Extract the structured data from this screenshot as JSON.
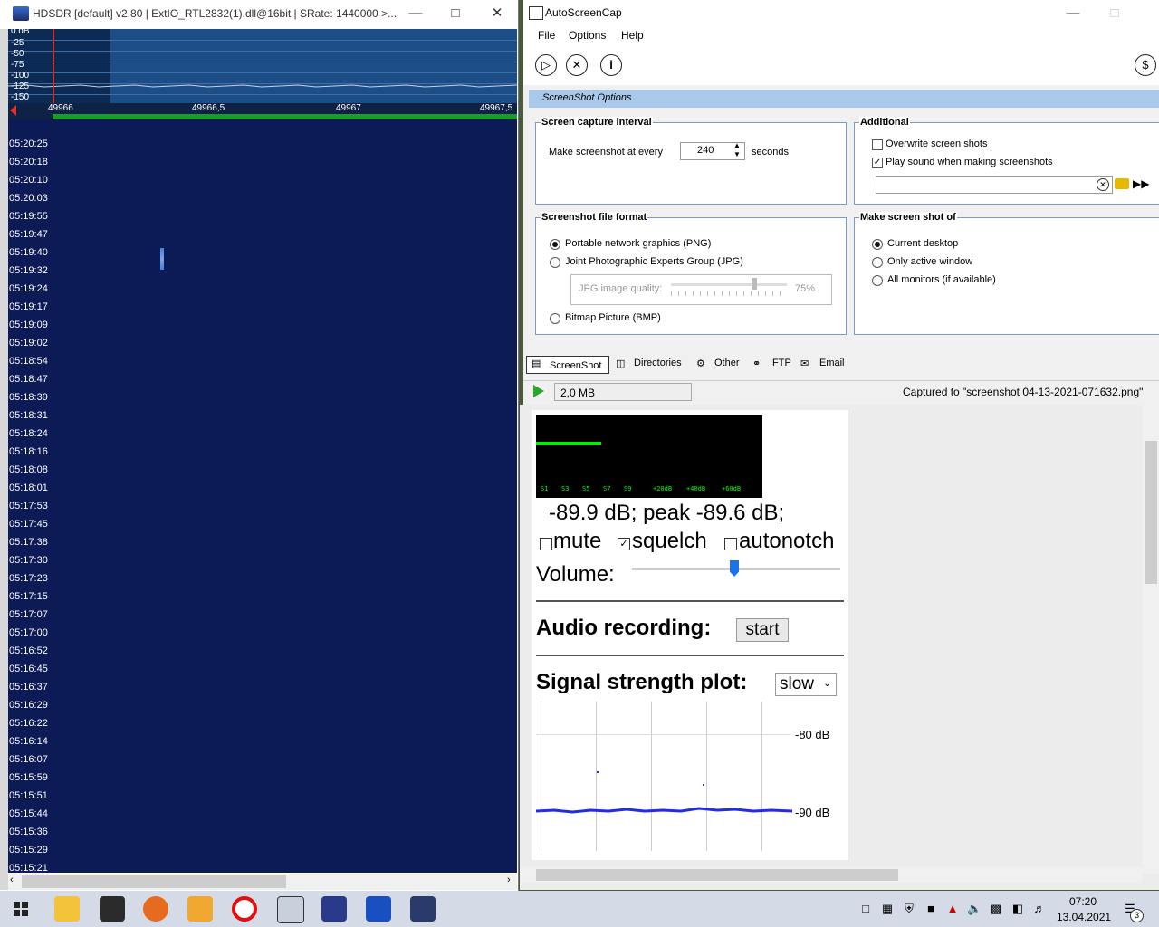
{
  "hdsdr": {
    "title": "HDSDR  [default]  v2.80   |   ExtIO_RTL2832(1).dll@16bit   |   SRate: 1440000 >...",
    "db_labels": [
      "0 dB",
      "-25",
      "-50",
      "-75",
      "-100",
      "-125",
      "-150"
    ],
    "freq_labels": [
      "49966",
      "49966,5",
      "49967",
      "49967,5"
    ],
    "timestamps": [
      "05:20:25",
      "05:20:18",
      "05:20:10",
      "05:20:03",
      "05:19:55",
      "05:19:47",
      "05:19:40",
      "05:19:32",
      "05:19:24",
      "05:19:17",
      "05:19:09",
      "05:19:02",
      "05:18:54",
      "05:18:47",
      "05:18:39",
      "05:18:31",
      "05:18:24",
      "05:18:16",
      "05:18:08",
      "05:18:01",
      "05:17:53",
      "05:17:45",
      "05:17:38",
      "05:17:30",
      "05:17:23",
      "05:17:15",
      "05:17:07",
      "05:17:00",
      "05:16:52",
      "05:16:45",
      "05:16:37",
      "05:16:29",
      "05:16:22",
      "05:16:14",
      "05:16:07",
      "05:15:59",
      "05:15:51",
      "05:15:44",
      "05:15:36",
      "05:15:29",
      "05:15:21"
    ]
  },
  "asc": {
    "title": "AutoScreenCap",
    "menu": {
      "file": "File",
      "options": "Options",
      "help": "Help"
    },
    "options_header": "ScreenShot Options",
    "interval": {
      "title": "Screen capture interval",
      "label": "Make screenshot at every",
      "value": "240",
      "unit": "seconds"
    },
    "additional": {
      "title": "Additional",
      "overwrite": "Overwrite screen shots",
      "play_sound": "Play sound when making screenshots",
      "overwrite_checked": false,
      "play_sound_checked": true
    },
    "format": {
      "title": "Screenshot file format",
      "png": "Portable network graphics (PNG)",
      "jpg": "Joint Photographic Experts Group (JPG)",
      "jpg_quality_label": "JPG image quality:",
      "jpg_quality_value": "75%",
      "bmp": "Bitmap Picture (BMP)",
      "selected": "png"
    },
    "shot_of": {
      "title": "Make screen shot of",
      "current": "Current desktop",
      "active": "Only active window",
      "monitors": "All monitors (if available)",
      "selected": "current"
    },
    "tabs": [
      "ScreenShot",
      "Directories",
      "Other",
      "FTP",
      "Email"
    ],
    "status": {
      "size": "2,0 MB",
      "captured": "Captured to \"screenshot 04-13-2021-071632.png\""
    }
  },
  "web": {
    "meter_ticks": [
      "S1",
      "S3",
      "S5",
      "S7",
      "S9",
      "+20dB",
      "+40dB",
      "+60dB"
    ],
    "meter_level": 0.29,
    "signal_text": "-89.9 dB; peak   -89.6 dB;",
    "mute": "mute",
    "squelch": "squelch",
    "autonotch": "autonotch",
    "mute_checked": false,
    "squelch_checked": true,
    "autonotch_checked": false,
    "volume_label": "Volume:",
    "volume_level": 0.51,
    "audio_recording": "Audio recording:",
    "start_button": "start",
    "plot_label": "Signal strength plot:",
    "plot_speed": "slow",
    "plot_y_labels": [
      "-80 dB",
      "-90 dB"
    ]
  },
  "taskbar": {
    "time": "07:20",
    "date": "13.04.2021",
    "notifications": "3"
  }
}
